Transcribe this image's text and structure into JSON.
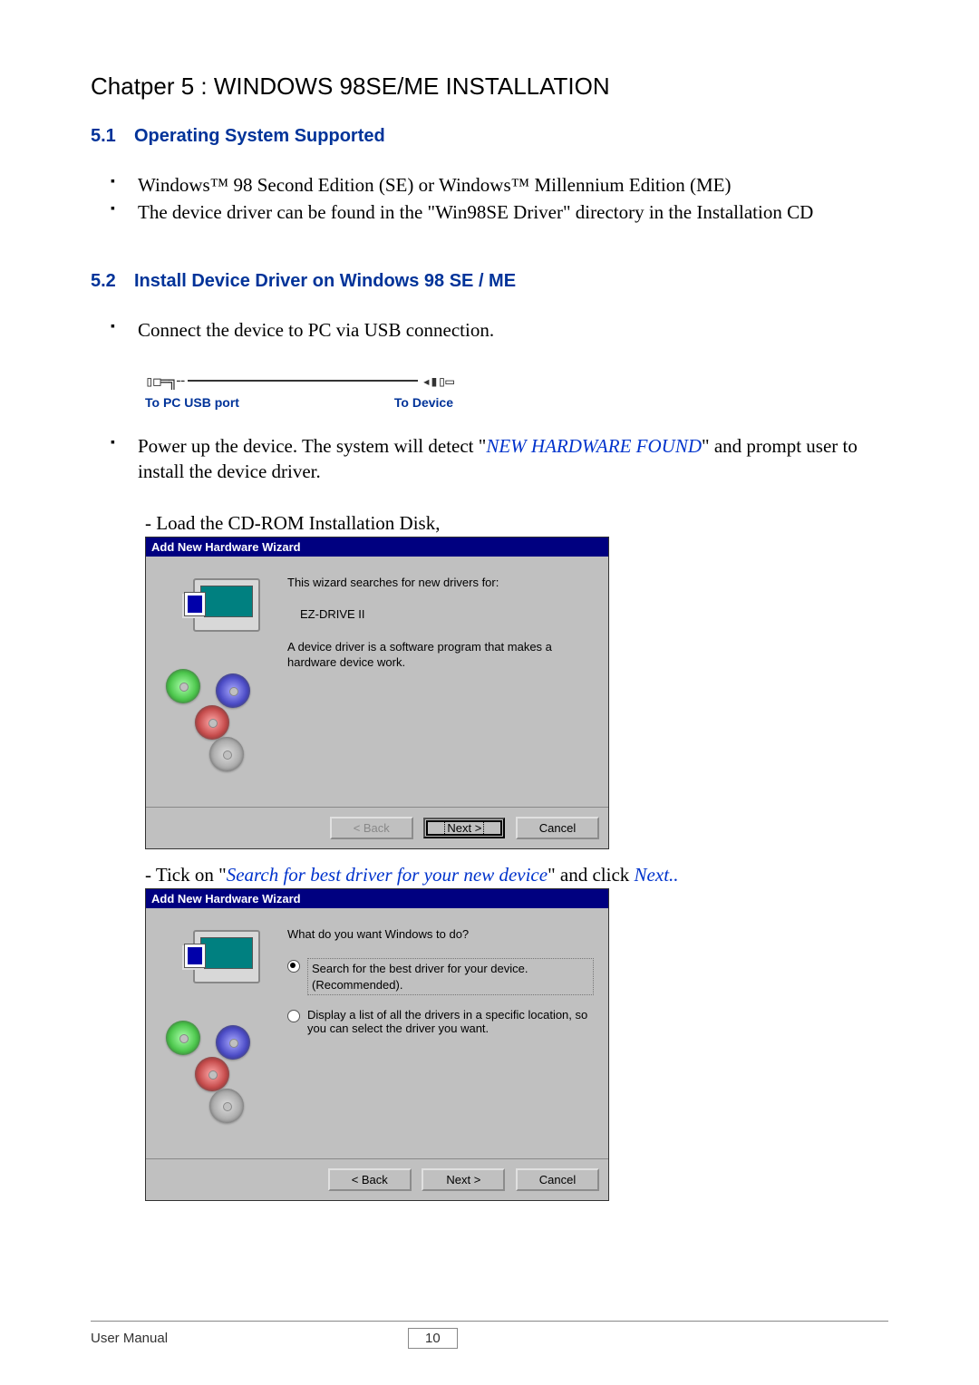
{
  "chapter_title_prefix": "Chatper 5  : ",
  "chapter_title_main": "WINDOWS 98SE/ME INSTALLATION",
  "section_5_1": {
    "num": "5.1",
    "title": "Operating System Supported",
    "bullets": [
      "Windows™ 98 Second Edition (SE) or Windows™ Millennium Edition (ME)",
      "The device driver can be found in the \"Win98SE Driver\" directory in the Installation CD"
    ]
  },
  "section_5_2": {
    "num": "5.2",
    "title": "Install Device Driver on Windows 98 SE / ME",
    "bullet_connect": "Connect the device to PC via USB connection.",
    "usb_left_label": "To PC USB port",
    "usb_right_label": "To Device",
    "bullet_powerup_pre": "Power up the device. The system will detect \"",
    "bullet_powerup_em": "NEW HARDWARE FOUND",
    "bullet_powerup_post": "\" and prompt user to install the device driver.",
    "sub_load_cd": "- Load the CD-ROM Installation Disk,",
    "wizard1": {
      "title": "Add New Hardware Wizard",
      "line1": "This wizard searches for new drivers for:",
      "device": "EZ-DRIVE II",
      "line2": "A device driver is a software program that makes a hardware device work.",
      "btn_back": "< Back",
      "btn_next": "Next >",
      "btn_cancel": "Cancel"
    },
    "tick_pre": "- Tick on \"",
    "tick_em": "Search for best driver for your new device",
    "tick_mid": "\" and click ",
    "tick_next": "Next..",
    "wizard2": {
      "title": "Add New Hardware Wizard",
      "prompt": "What do you want Windows to do?",
      "opt1": "Search for the best driver for your device. (Recommended).",
      "opt2": "Display a list of all the drivers in a specific location, so you can select the driver you want.",
      "btn_back": "< Back",
      "btn_next": "Next >",
      "btn_cancel": "Cancel"
    }
  },
  "footer": {
    "label": "User Manual",
    "page": "10"
  }
}
